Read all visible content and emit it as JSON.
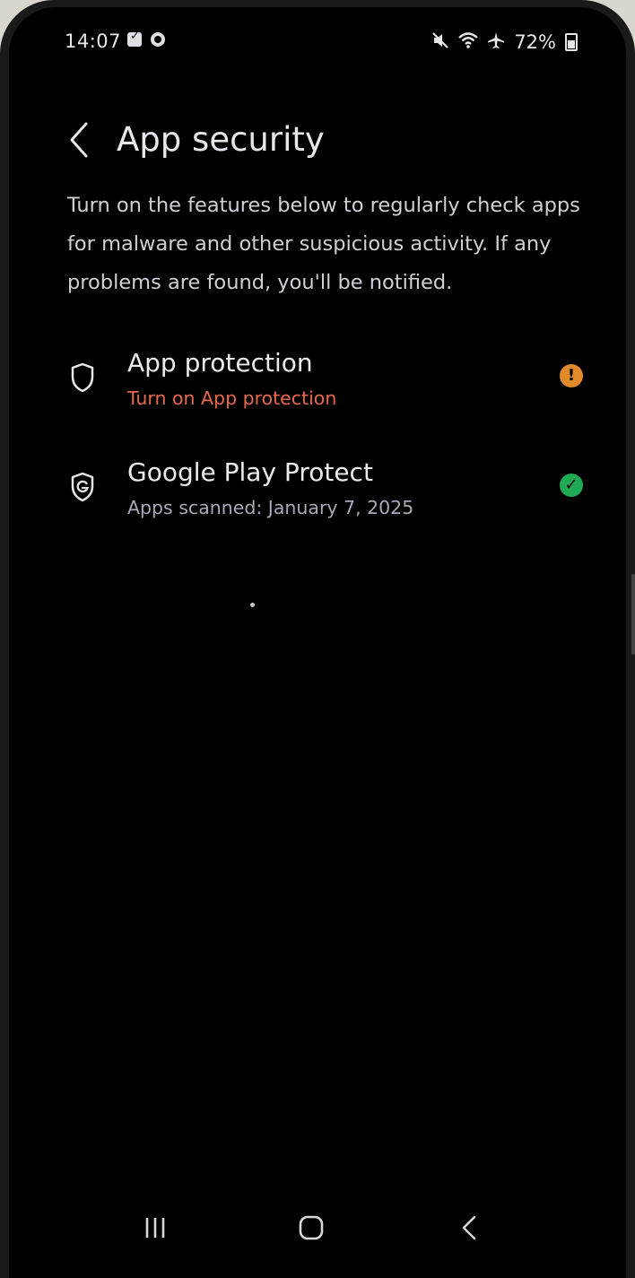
{
  "status_bar": {
    "time": "14:07",
    "battery": "72%",
    "icons": [
      "checkbox-notification-icon",
      "circle-notification-icon",
      "mute-icon",
      "wifi-icon",
      "airplane-icon",
      "battery-icon"
    ]
  },
  "header": {
    "title": "App security"
  },
  "description": "Turn on the features below to regularly check apps for malware and other suspicious activity. If any problems are found, you'll be notified.",
  "items": [
    {
      "title": "App protection",
      "subtitle": "Turn on App protection",
      "icon": "shield-icon",
      "status_icon": "warning-icon",
      "status_glyph": "!",
      "subtitle_color": "#e8694a",
      "status_color": "#e08a2a"
    },
    {
      "title": "Google Play Protect",
      "subtitle": "Apps scanned: January 7, 2025",
      "icon": "google-shield-icon",
      "status_icon": "check-icon",
      "status_glyph": "✓",
      "subtitle_color": "#a9a9b8",
      "status_color": "#1faa55"
    }
  ],
  "nav": {
    "recents": "recents-icon",
    "home": "home-icon",
    "back": "back-icon"
  },
  "colors": {
    "background": "#000000",
    "warning": "#e08a2a",
    "success": "#1faa55"
  }
}
